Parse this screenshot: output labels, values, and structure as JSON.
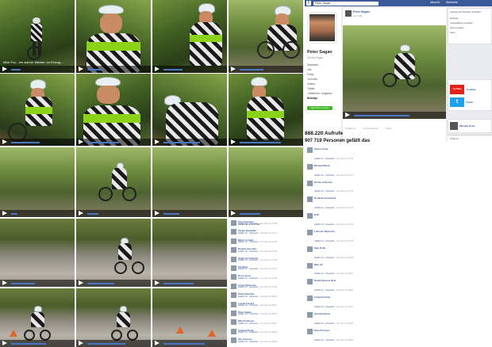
{
  "video_frames": {
    "f1_caption": "Mike Fox - ein wahrer Meister, im Einzug..."
  },
  "facebook": {
    "topbar": {
      "logo": "f",
      "search_value": "Peter Sagan",
      "user_label": "Marcelo",
      "home_label": "Startseite"
    },
    "profile": {
      "name": "Peter Sagan",
      "handle": "@PeterSagan",
      "nav": [
        "Startseite",
        "Info",
        "Fotos",
        "YouTube",
        "Videos",
        "Twitter",
        "„Gefällt mir\"-Angaben",
        "Beiträge"
      ],
      "active_nav": "Beiträge",
      "cta_label": "Nachricht senden"
    },
    "post": {
      "author": "Peter Sagan",
      "sub": "vor 3 Std. ·",
      "text": "",
      "actions": [
        "Gefällt mir",
        "Kommentieren",
        "Teilen"
      ]
    },
    "side": {
      "header": "Sprache auf Deutsch umstellen",
      "lines": [
        "Einladen",
        "Veranstaltung erstellen",
        "Seite erstellen",
        "Seite"
      ],
      "youtube_label": "YouTube",
      "youtube_thumb": "YouTube",
      "twitter_label": "Twitter",
      "twitter_thumb": "t",
      "related_label": "Michael Hofer",
      "chat_label": "Chat (3)"
    }
  },
  "stats": {
    "views": "888.220 Aufrufe",
    "likes": "907 719 Personen gefällt das"
  },
  "comments_left": [
    {
      "name": "Tom Ferguson",
      "text": "Looks like a lot of fun!",
      "meta": "16. April um 17:05"
    },
    {
      "name": "Sergio Bengtalin",
      "text": "",
      "meta": "16. April um 17:14"
    },
    {
      "name": "Marco Ferrara",
      "text": "",
      "meta": "16. April um 17:18"
    },
    {
      "name": "Daniele Guerrieri",
      "text": "",
      "meta": "16. April um 17:22"
    },
    {
      "name": "Heath Ira Schmidt",
      "text": "",
      "meta": "16. April um 17:28"
    },
    {
      "name": "Pat Ward",
      "text": "",
      "meta": "16. April um 17:31"
    },
    {
      "name": "Rosa Jones",
      "text": "",
      "meta": "16. April um 17:40"
    },
    {
      "name": "Anna Zimburova",
      "text": "",
      "meta": "16. April um 17:52"
    },
    {
      "name": "David Rinehart",
      "text": "",
      "meta": "16. April um 18:01"
    },
    {
      "name": "Lucian Ferrara",
      "text": "",
      "meta": "16. April um 18:10"
    },
    {
      "name": "Peter Sagan",
      "text": "",
      "meta": "16. April um 18:14"
    },
    {
      "name": "Mike Pedersen",
      "text": "",
      "meta": "16. April um 18:21"
    },
    {
      "name": "Andrew Wong",
      "text": "",
      "meta": "16. April um 18:30"
    },
    {
      "name": "Jan Janssen",
      "text": "",
      "meta": "16. April um 18:44"
    }
  ],
  "comments_right": [
    {
      "name": "Steven Volaj",
      "text": "",
      "meta": "16. April um 17:05"
    },
    {
      "name": "Michael Nilsen",
      "text": "",
      "meta": "16. April um 17:11"
    },
    {
      "name": "Darren H Barnes",
      "text": "",
      "meta": "16. April um 17:20"
    },
    {
      "name": "Dominik Osowiasek",
      "text": "",
      "meta": "16. April um 17:33"
    },
    {
      "name": "R.W.",
      "text": "",
      "meta": "16. April um 17:39"
    },
    {
      "name": "Lubomir Taparovic",
      "text": "",
      "meta": "16. April um 17:46"
    },
    {
      "name": "Sam Rolfe",
      "text": "",
      "meta": "16. April um 17:58"
    },
    {
      "name": "Niko ZF",
      "text": "",
      "meta": "16. April um 18:07"
    },
    {
      "name": "Robert Barrios Ruiz",
      "text": "",
      "meta": "16. April um 18:19"
    },
    {
      "name": "Craig Donnelly",
      "text": "",
      "meta": "16. April um 18:27"
    },
    {
      "name": "Igor Brankovic",
      "text": "",
      "meta": "16. April um 18:40"
    },
    {
      "name": "Dino Pirovano",
      "text": "",
      "meta": "16. April um 18:52"
    }
  ],
  "comment_actions": {
    "like": "Gefällt mir",
    "reply": "Antworten"
  }
}
